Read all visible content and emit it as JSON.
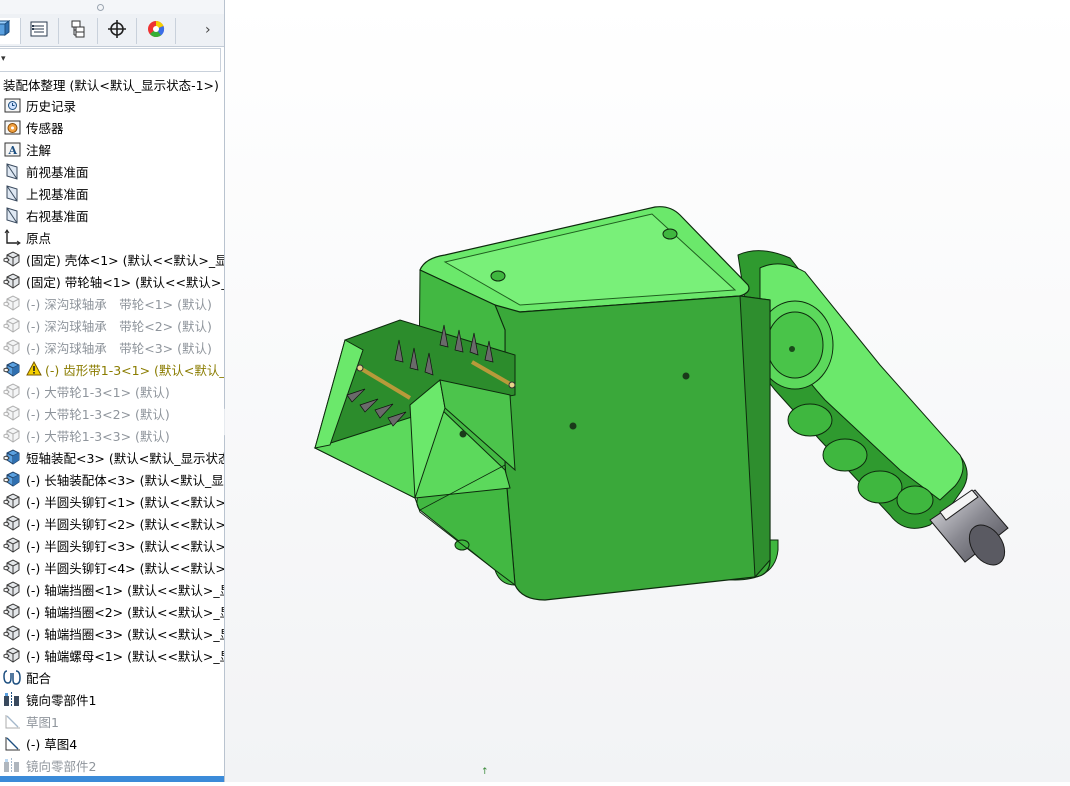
{
  "tabs": [
    {
      "icon": "feature-manager-icon"
    },
    {
      "icon": "property-manager-icon"
    },
    {
      "icon": "configuration-manager-icon"
    },
    {
      "icon": "dimxpert-icon"
    },
    {
      "icon": "display-manager-icon"
    }
  ],
  "tree": {
    "root": "装配体整理 (默认<默认_显示状态-1>)",
    "items": [
      {
        "label": "历史记录",
        "icon": "history-icon"
      },
      {
        "label": "传感器",
        "icon": "sensor-icon"
      },
      {
        "label": "注解",
        "icon": "annotation-icon"
      },
      {
        "label": "前视基准面",
        "icon": "plane-icon"
      },
      {
        "label": "上视基准面",
        "icon": "plane-icon"
      },
      {
        "label": "右视基准面",
        "icon": "plane-icon"
      },
      {
        "label": "原点",
        "icon": "origin-icon"
      },
      {
        "label": "(固定) 壳体<1> (默认<<默认>_显示",
        "icon": "part-icon"
      },
      {
        "label": "(固定) 带轮轴<1> (默认<<默认>_显",
        "icon": "part-icon"
      },
      {
        "label": "(-) 深沟球轴承　带轮<1> (默认)",
        "icon": "part-icon",
        "state": "suppressed"
      },
      {
        "label": "(-) 深沟球轴承　带轮<2> (默认)",
        "icon": "part-icon",
        "state": "suppressed"
      },
      {
        "label": "(-) 深沟球轴承　带轮<3> (默认)",
        "icon": "part-icon",
        "state": "suppressed"
      },
      {
        "label": "(-) 齿形带1-3<1> (默认<默认_显",
        "icon": "subassembly-icon",
        "state": "warning"
      },
      {
        "label": "(-) 大带轮1-3<1> (默认)",
        "icon": "part-icon",
        "state": "suppressed"
      },
      {
        "label": "(-) 大带轮1-3<2> (默认)",
        "icon": "part-icon",
        "state": "suppressed"
      },
      {
        "label": "(-) 大带轮1-3<3> (默认)",
        "icon": "part-icon",
        "state": "suppressed"
      },
      {
        "label": "短轴装配<3> (默认<默认_显示状态-",
        "icon": "subassembly-icon"
      },
      {
        "label": "(-) 长轴装配体<3> (默认<默认_显示",
        "icon": "subassembly-icon"
      },
      {
        "label": "(-) 半圆头铆钉<1> (默认<<默认>_显",
        "icon": "part-icon"
      },
      {
        "label": "(-) 半圆头铆钉<2> (默认<<默认>_显",
        "icon": "part-icon"
      },
      {
        "label": "(-) 半圆头铆钉<3> (默认<<默认>_显",
        "icon": "part-icon"
      },
      {
        "label": "(-) 半圆头铆钉<4> (默认<<默认>_显",
        "icon": "part-icon"
      },
      {
        "label": "(-) 轴端挡圈<1> (默认<<默认>_显示",
        "icon": "part-icon"
      },
      {
        "label": "(-) 轴端挡圈<2> (默认<<默认>_显示",
        "icon": "part-icon"
      },
      {
        "label": "(-) 轴端挡圈<3> (默认<<默认>_显示",
        "icon": "part-icon"
      },
      {
        "label": "(-) 轴端螺母<1> (默认<<默认>_显示",
        "icon": "part-icon"
      },
      {
        "label": "配合",
        "icon": "mates-icon"
      },
      {
        "label": "镜向零部件1",
        "icon": "mirror-component-icon"
      },
      {
        "label": "草图1",
        "icon": "sketch-icon",
        "state": "suppressed"
      },
      {
        "label": "(-) 草图4",
        "icon": "sketch-icon"
      },
      {
        "label": "镜向零部件2",
        "icon": "mirror-component-icon",
        "state": "suppressed"
      }
    ]
  },
  "colors": {
    "model_green": "#6be86b",
    "model_green_dark": "#2f8f2f",
    "edge": "#0d2a0d",
    "suppressed_text": "#8f959c",
    "warning_text": "#8a7c00",
    "selection_blue": "#3b8bd9"
  }
}
